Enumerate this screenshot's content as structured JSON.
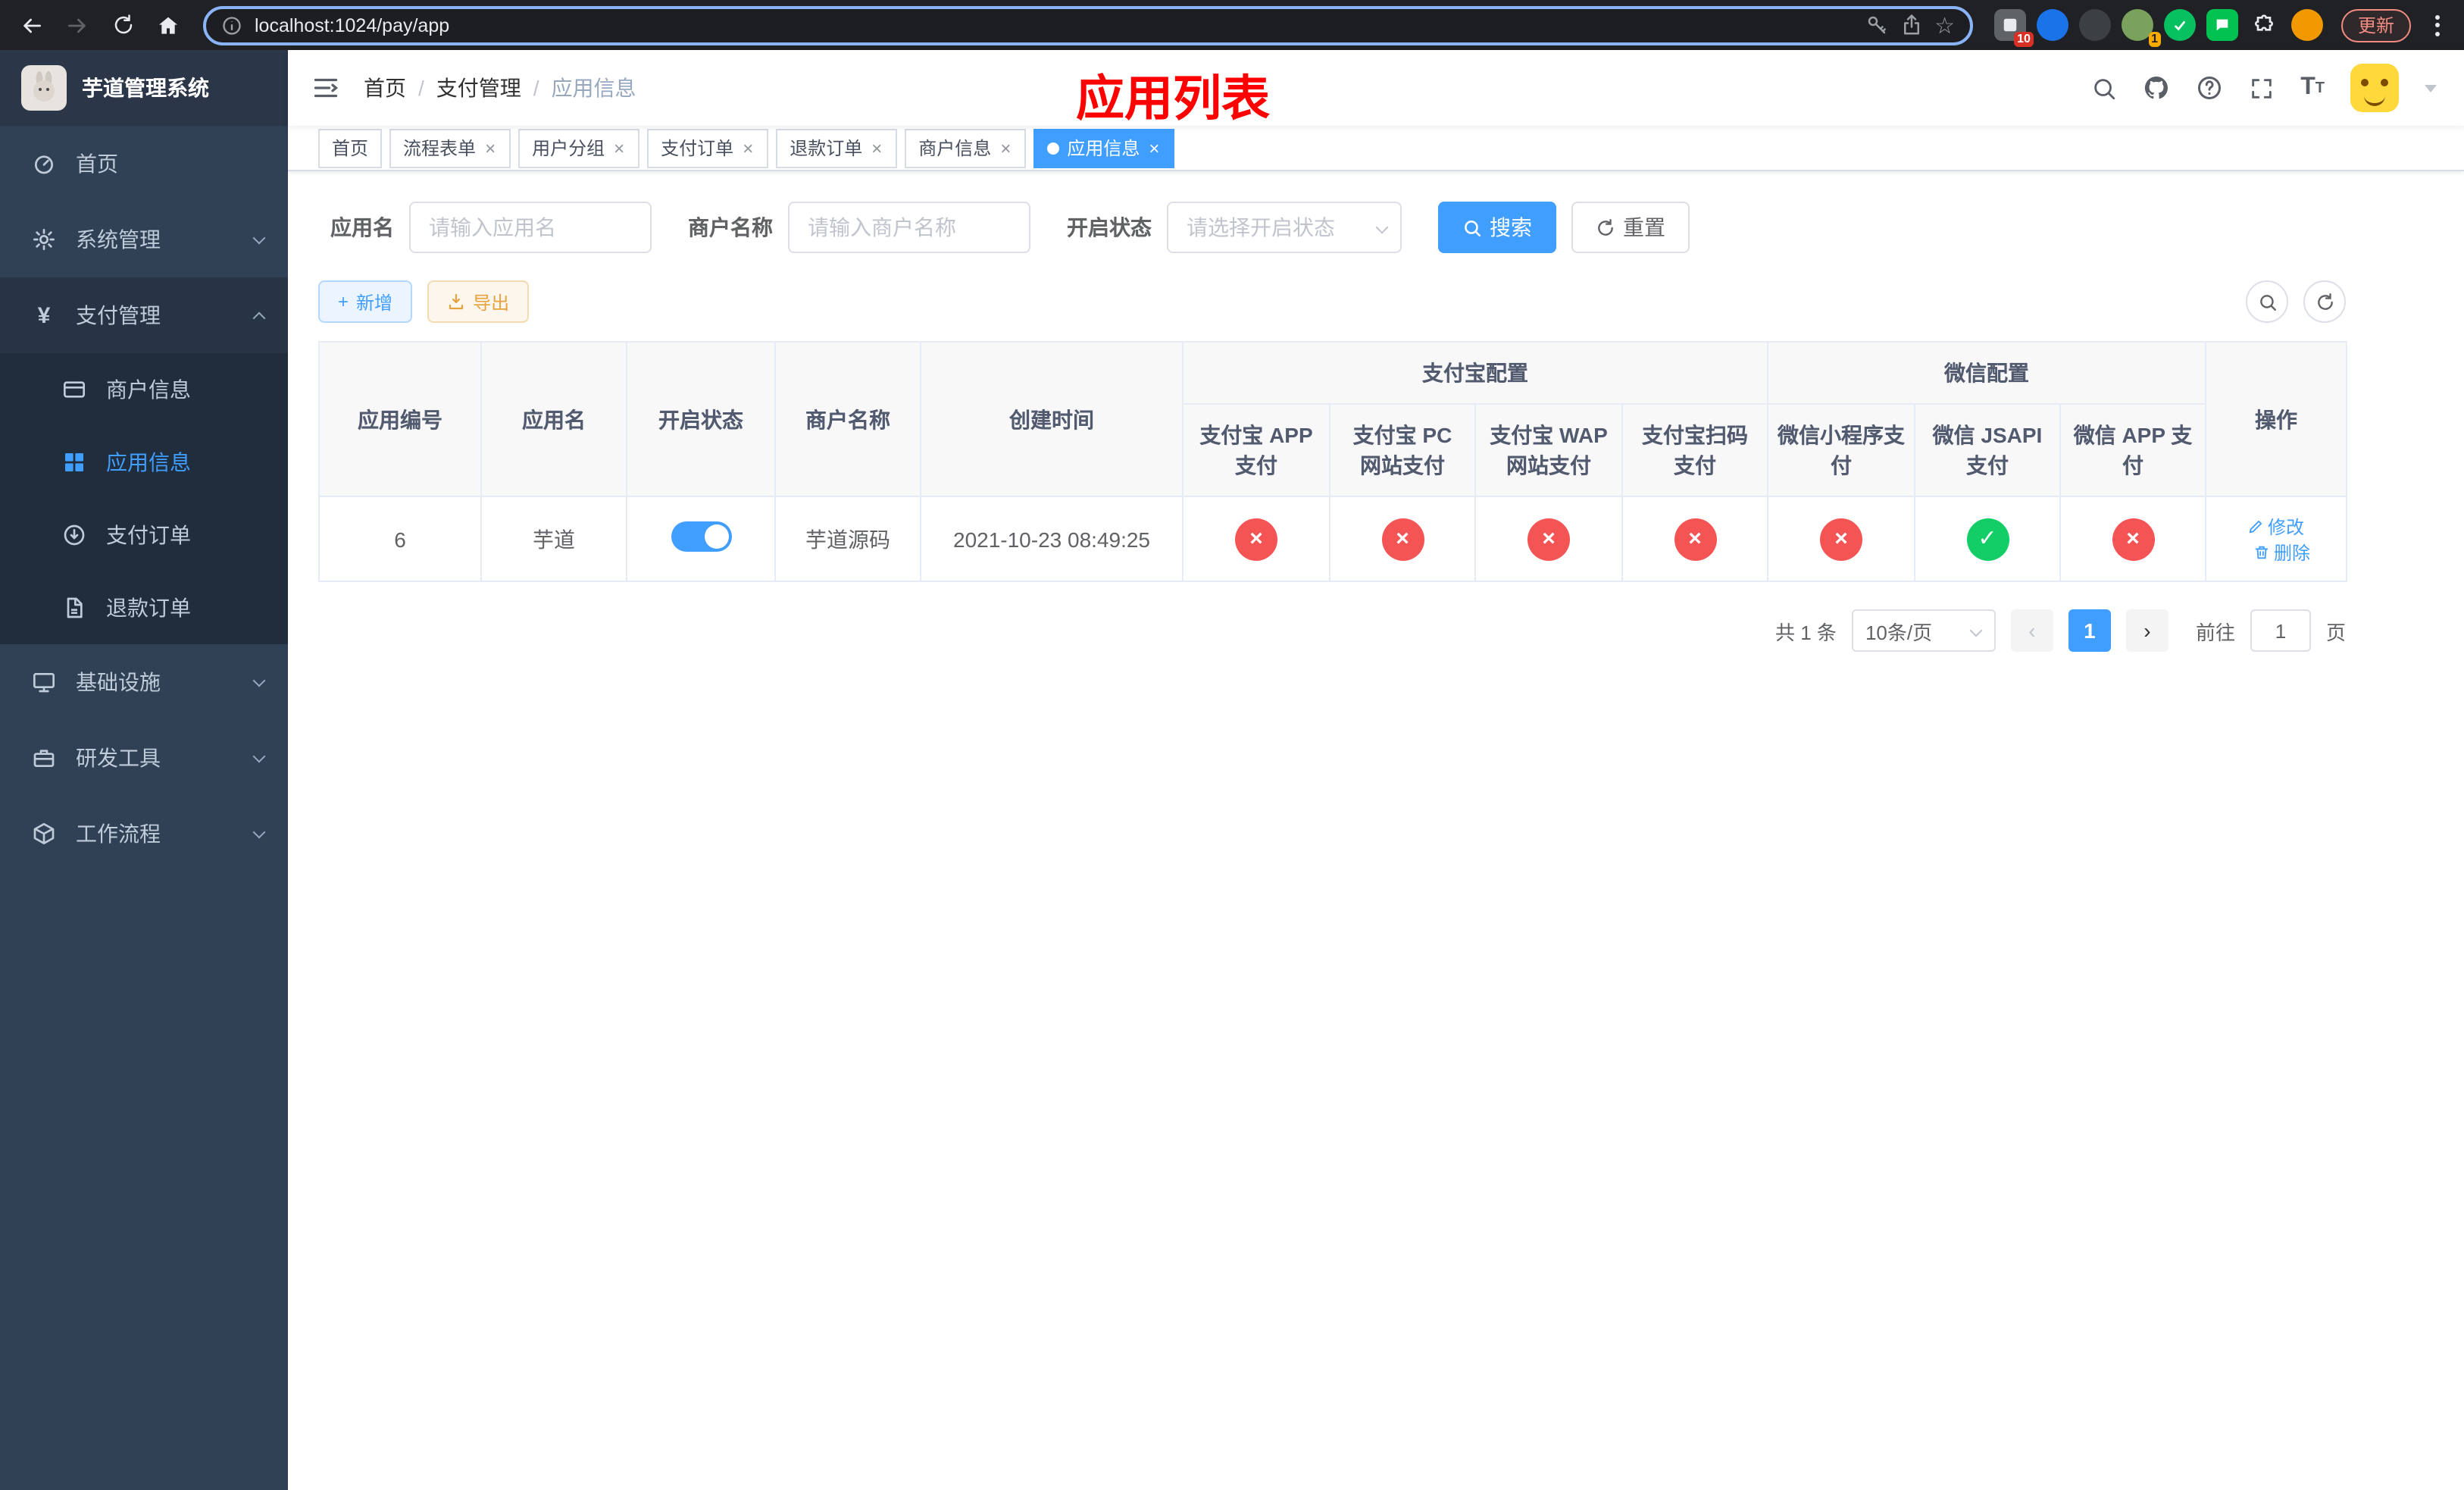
{
  "colors": {
    "accent": "#409eff",
    "danger": "#f45454",
    "success": "#13ce66",
    "warning": "#e6a23c",
    "annotation-red": "#ff0000"
  },
  "icons": {
    "yen": "¥",
    "info": "i",
    "star": "☆",
    "question": "?",
    "plus": "+",
    "check": "✓",
    "cross": "×",
    "close": "×",
    "page_prev": "‹",
    "page_next": "›",
    "breadcrumb_separator": "/",
    "font_size_large": "T",
    "font_size_small": "T"
  },
  "browser": {
    "url": "localhost:1024/pay/app",
    "update_label": "更新",
    "extension_badge": "10",
    "avatar_badge": "1"
  },
  "sidebar": {
    "logo_title": "芋道管理系统",
    "items": [
      {
        "label": "首页"
      },
      {
        "label": "系统管理"
      },
      {
        "label": "支付管理"
      },
      {
        "label": "商户信息"
      },
      {
        "label": "应用信息"
      },
      {
        "label": "支付订单"
      },
      {
        "label": "退款订单"
      },
      {
        "label": "基础设施"
      },
      {
        "label": "研发工具"
      },
      {
        "label": "工作流程"
      }
    ]
  },
  "header": {
    "breadcrumb": [
      "首页",
      "支付管理",
      "应用信息"
    ],
    "overlay_title": "应用列表"
  },
  "tabs": [
    {
      "label": "首页"
    },
    {
      "label": "流程表单"
    },
    {
      "label": "用户分组"
    },
    {
      "label": "支付订单"
    },
    {
      "label": "退款订单"
    },
    {
      "label": "商户信息"
    },
    {
      "label": "应用信息"
    }
  ],
  "filters": {
    "app_name_label": "应用名",
    "app_name_placeholder": "请输入应用名",
    "merchant_label": "商户名称",
    "merchant_placeholder": "请输入商户名称",
    "status_label": "开启状态",
    "status_placeholder": "请选择开启状态",
    "search_label": "搜索",
    "reset_label": "重置"
  },
  "toolbar": {
    "add_label": "新增",
    "export_label": "导出"
  },
  "table": {
    "group_alipay": "支付宝配置",
    "group_wechat": "微信配置",
    "col_id": "应用编号",
    "col_name": "应用名",
    "col_status": "开启状态",
    "col_merchant": "商户名称",
    "col_created": "创建时间",
    "col_alipay_app": "支付宝 APP 支付",
    "col_alipay_pc": "支付宝 PC 网站支付",
    "col_alipay_wap": "支付宝 WAP 网站支付",
    "col_alipay_qr": "支付宝扫码支付",
    "col_wechat_mini": "微信小程序支付",
    "col_wechat_jsapi": "微信 JSAPI 支付",
    "col_wechat_app": "微信 APP 支付",
    "col_actions": "操作",
    "rows": [
      {
        "id": "6",
        "name": "芋道",
        "enabled": true,
        "merchant": "芋道源码",
        "created": "2021-10-23 08:49:25",
        "alipay_app": false,
        "alipay_pc": false,
        "alipay_wap": false,
        "alipay_qr": false,
        "wechat_mini": false,
        "wechat_jsapi": true,
        "wechat_app": false,
        "edit_label": "修改",
        "delete_label": "删除"
      }
    ]
  },
  "pagination": {
    "total_label": "共 1 条",
    "page_size_label": "10条/页",
    "current_page": "1",
    "goto_label": "前往",
    "goto_value": "1",
    "page_unit": "页"
  }
}
